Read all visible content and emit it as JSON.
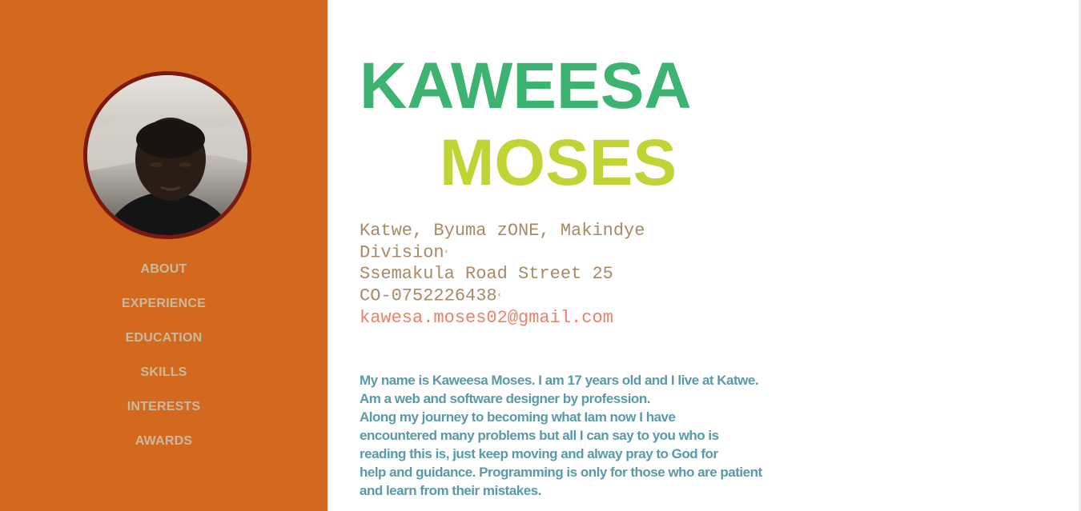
{
  "sidebar": {
    "color": "#d2691e",
    "avatar_icon": "profile-photo",
    "nav": [
      {
        "label": "ABOUT"
      },
      {
        "label": "EXPERIENCE"
      },
      {
        "label": "EDUCATION"
      },
      {
        "label": "SKILLS"
      },
      {
        "label": "INTERESTS"
      },
      {
        "label": "AWARDS"
      }
    ]
  },
  "header": {
    "first_name": "KAWEESA",
    "last_name": "MOSES",
    "first_name_color": "#3cb371",
    "last_name_color": "#c0d436"
  },
  "contact": {
    "address_line1": "Katwe, Byuma zONE, Makindye",
    "address_line2": "Division",
    "street": "Ssemakula Road Street 25",
    "phone": "CO-0752226438",
    "email": "kawesa.moses02@gmail.com"
  },
  "bio": {
    "lines": [
      "My name is Kaweesa Moses. I am 17 years old and I live at Katwe.",
      "Am a web and software designer by profession.",
      "Along my journey to becoming what Iam now I have",
      "encountered many problems but all I can say to you who is",
      "reading this is, just keep moving and alway pray to God for",
      "help and guidance. Programming is only for those who are patient",
      "and learn from their mistakes."
    ]
  }
}
